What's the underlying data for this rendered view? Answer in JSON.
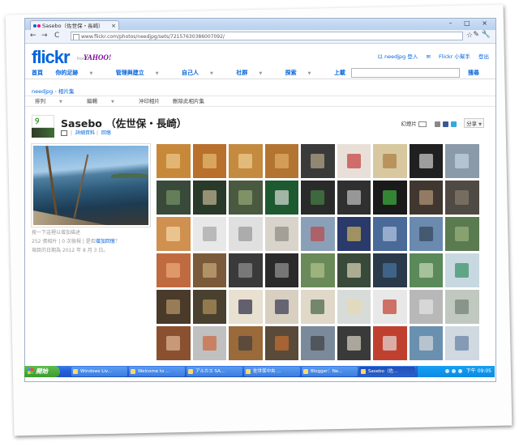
{
  "browser": {
    "tab_title": "Sasebo（佐世保・長崎）",
    "tab_close": "×",
    "window_controls": "– □ ×",
    "back": "←",
    "forward": "→",
    "reload": "C",
    "url": "www.flickr.com/photos/needjpg/sets/72157630386007092/",
    "star": "☆",
    "tools": "✎ 🔧"
  },
  "header": {
    "logo_part1": "flickr",
    "logo_part2": "",
    "from": "from",
    "yahoo": "YAHOO!",
    "user_items": [
      "以 needjpg 登入",
      "Flickr 小幫手",
      "登出"
    ],
    "nav": [
      "首頁",
      "你的足跡",
      "管理與建立",
      "自己人",
      "社群",
      "探索",
      "上載"
    ],
    "search_label": "搜尋"
  },
  "breadcrumb": {
    "user": "needjpg",
    "sep": " › ",
    "section": "相片集"
  },
  "subnav": [
    "排列",
    "編輯",
    "沖印相片",
    "刪除此相片集"
  ],
  "set": {
    "title": "Sasebo （佐世保・長崎）",
    "details": "詳細資料",
    "map": "回憶",
    "slideshow": "幻燈片",
    "share": "分享",
    "info": {
      "prompt": "按一下這裡以增加描述",
      "counts": "252 張相片 | 0 次檢視 | 是否",
      "link": "增加回憶",
      "tail": "？",
      "date": "項目的日期為 2012 年 8 月 3 日。"
    }
  },
  "thumbnails": [
    {
      "bg": "#c8883a",
      "a": "#f0d090"
    },
    {
      "bg": "#b8702c",
      "a": "#e8c27a"
    },
    {
      "bg": "#c48a40",
      "a": "#f2d49a"
    },
    {
      "bg": "#b37432",
      "a": "#e6b46c"
    },
    {
      "bg": "#3a3a3a",
      "a": "#c0b090"
    },
    {
      "bg": "#e8e0d8",
      "a": "#c03030"
    },
    {
      "bg": "#d8c8a0",
      "a": "#a87838"
    },
    {
      "bg": "#202020",
      "a": "#e0e0e0"
    },
    {
      "bg": "#8a9aa8",
      "a": "#c8d8e8"
    },
    {
      "bg": "#3a4a3a",
      "a": "#7a9a6a"
    },
    {
      "bg": "#2a3a2a",
      "a": "#d0c0a0"
    },
    {
      "bg": "#4a5a40",
      "a": "#9ab07a"
    },
    {
      "bg": "#1e5a30",
      "a": "#e8e8e8"
    },
    {
      "bg": "#2a2a2a",
      "a": "#4a8a4a"
    },
    {
      "bg": "#303030",
      "a": "#d0d0d0"
    },
    {
      "bg": "#1a1a1a",
      "a": "#40c040"
    },
    {
      "bg": "#403830",
      "a": "#c0a080"
    },
    {
      "bg": "#504a44",
      "a": "#8a8070"
    },
    {
      "bg": "#d09050",
      "a": "#f8e0b0"
    },
    {
      "bg": "#e8e8e8",
      "a": "#a0a0a0"
    },
    {
      "bg": "#e0e0e0",
      "a": "#909090"
    },
    {
      "bg": "#d8d4cc",
      "a": "#8a8478"
    },
    {
      "bg": "#8aa0b8",
      "a": "#c04040"
    },
    {
      "bg": "#2a3a6a",
      "a": "#e0c060"
    },
    {
      "bg": "#4a6a9a",
      "a": "#c0d0e8"
    },
    {
      "bg": "#6a8ab0",
      "a": "#304050"
    },
    {
      "bg": "#5a7a50",
      "a": "#a0b880"
    },
    {
      "bg": "#c06a40",
      "a": "#f0b080"
    },
    {
      "bg": "#7a5a3a",
      "a": "#d0b080"
    },
    {
      "bg": "#3a3a3a",
      "a": "#9a9a9a"
    },
    {
      "bg": "#2a2a2a",
      "a": "#a0a0a0"
    },
    {
      "bg": "#6a8a5a",
      "a": "#b8c890"
    },
    {
      "bg": "#3a4a3a",
      "a": "#e8e0c0"
    },
    {
      "bg": "#2a3a4a",
      "a": "#4a7aa8"
    },
    {
      "bg": "#5a8a5a",
      "a": "#d0e0c0"
    },
    {
      "bg": "#c8d8e0",
      "a": "#2a8a5a"
    },
    {
      "bg": "#4a3a2a",
      "a": "#c0a070"
    },
    {
      "bg": "#4a4030",
      "a": "#b89a60"
    },
    {
      "bg": "#e8e0d0",
      "a": "#1a1a3a"
    },
    {
      "bg": "#d8cfc0",
      "a": "#2a2a4a"
    },
    {
      "bg": "#e0d8c8",
      "a": "#3a5a3a"
    },
    {
      "bg": "#d8dcd8",
      "a": "#e8d8b0"
    },
    {
      "bg": "#e8e8e8",
      "a": "#c03020"
    },
    {
      "bg": "#b8b8b8",
      "a": "#e8e8e8"
    },
    {
      "bg": "#c0c8c0",
      "a": "#6a7a6a"
    },
    {
      "bg": "#8a5030",
      "a": "#e8c0a0"
    },
    {
      "bg": "#c0c0c0",
      "a": "#d06030"
    },
    {
      "bg": "#9a6a3a",
      "a": "#3a3a3a"
    },
    {
      "bg": "#5a4a3a",
      "a": "#d07030"
    },
    {
      "bg": "#7a8a9a",
      "a": "#3a3a3a"
    },
    {
      "bg": "#3a3a3a",
      "a": "#e8e0d0"
    },
    {
      "bg": "#c04030",
      "a": "#e8e8e8"
    },
    {
      "bg": "#6a90b0",
      "a": "#e0e0e0"
    },
    {
      "bg": "#d0d8e0",
      "a": "#5a7aa0"
    }
  ],
  "taskbar": {
    "start": "開始",
    "tasks": [
      "Windows Liv...",
      "Welcome to ...",
      "アルカス SA...",
      "佐世保中央 ...",
      "Blogger：Ne...",
      "Sasebo（佐..."
    ],
    "active_index": 5,
    "clock": "下午 09:05"
  }
}
